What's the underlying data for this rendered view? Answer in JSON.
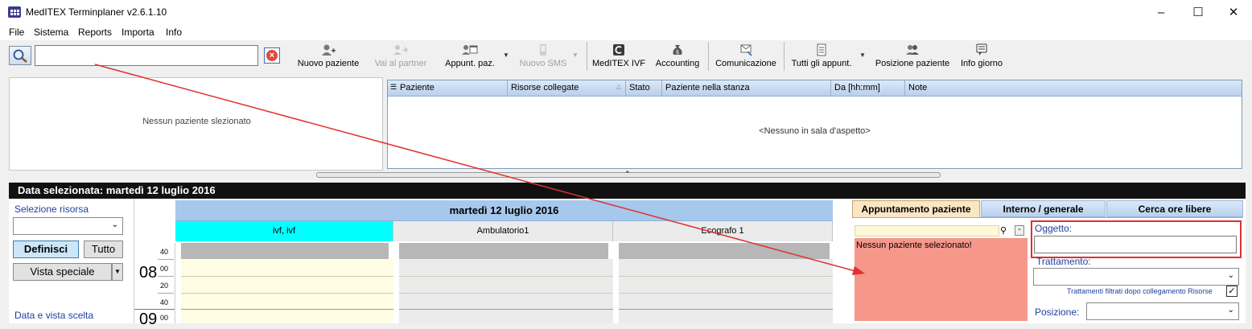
{
  "window": {
    "title": "MedITEX Terminplaner  v2.6.1.10",
    "min_icon": "minimize-icon",
    "max_icon": "maximize-icon",
    "close_icon": "close-icon"
  },
  "menu": [
    "File",
    "Sistema",
    "Reports",
    "Importa",
    "Info"
  ],
  "search": {
    "value": "",
    "placeholder": ""
  },
  "toolbar": {
    "nuovo_paziente": "Nuovo paziente",
    "vai_al_partner": "Vai al partner",
    "appunt_paz": "Appunt. paz.",
    "nuovo_sms": "Nuovo SMS",
    "meditex_ivf": "MedITEX IVF",
    "accounting": "Accounting",
    "comunicazione": "Comunicazione",
    "tutti_gli_appunt": "Tutti gli appunt.",
    "posizione_paziente": "Posizione paziente",
    "info_giorno": "Info giorno"
  },
  "patient_panel": {
    "empty_text": "Nessun paziente slezionato"
  },
  "waiting_room": {
    "columns": [
      "Paziente",
      "Risorse collegate",
      "Stato",
      "Paziente nella stanza",
      "Da [hh:mm]",
      "Note"
    ],
    "empty_text": "<Nessuno in sala d'aspetto>"
  },
  "date_bar": {
    "text": "Data selezionata:  martedì 12 luglio 2016"
  },
  "left": {
    "resource_label": "Selezione risorsa",
    "resource_value": "",
    "definisci": "Definisci",
    "tutto": "Tutto",
    "vista_speciale": "Vista speciale",
    "data_label": "Data e vista scelta"
  },
  "calendar": {
    "date_header": "martedì 12 luglio 2016",
    "resources": [
      "ivf, ivf",
      "Ambulatorio1",
      "Ecografo 1"
    ],
    "resource_colors": [
      "#00ffff",
      "#ebebeb",
      "#ebebeb"
    ],
    "time_labels": {
      "r40a": "40",
      "h08": "08",
      "m00a": "00",
      "m20": "20",
      "r40b": "40",
      "h09": "09",
      "m00b": "00"
    }
  },
  "right": {
    "tabs": [
      "Appuntamento paziente",
      "Interno / generale",
      "Cerca ore libere"
    ],
    "patient_box_text": "Nessun paziente selezionato!",
    "oggetto_label": "Oggetto:",
    "oggetto_value": "",
    "trattamento_label": "Trattamento:",
    "trattamento_value": "",
    "trattamenti_note": "Trattamenti filtrati dopo collegamento Risorse",
    "trattamenti_checked": true,
    "posizione_label": "Posizione:",
    "posizione_value": ""
  },
  "annotation": {
    "color": "#e03030"
  }
}
